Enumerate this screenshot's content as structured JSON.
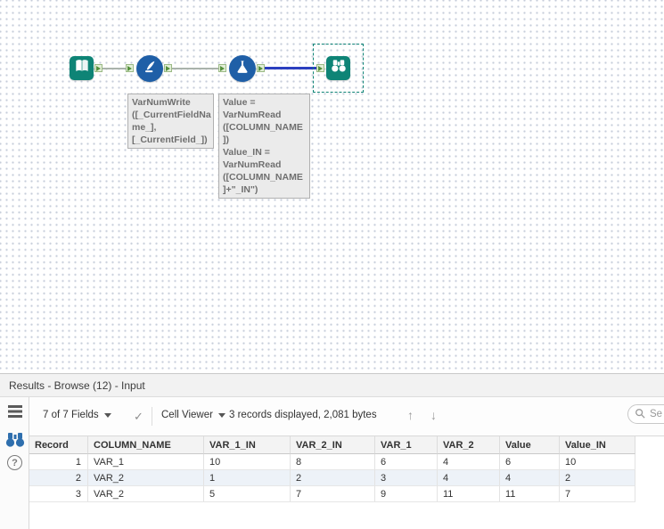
{
  "colors": {
    "tool_teal": "#0E8476",
    "tool_blue": "#1F5FA7",
    "selected_connection": "#2B3FBF",
    "selection_outline": "#0E8476"
  },
  "canvas": {
    "annotations": {
      "write_formula": "VarNumWrite\n([_CurrentFieldNa\nme_],\n[_CurrentField_])",
      "read_formula": "Value =\nVarNumRead\n([COLUMN_NAME\n])\nValue_IN =\nVarNumRead\n([COLUMN_NAME\n]+\"_IN\")"
    }
  },
  "results": {
    "title": "Results - Browse (12) - Input",
    "toolbar": {
      "fields": "7 of 7 Fields",
      "cell_viewer": "Cell Viewer",
      "records": "3 records displayed, 2,081 bytes",
      "search_placeholder": "Se"
    },
    "table": {
      "columns": [
        "Record",
        "COLUMN_NAME",
        "VAR_1_IN",
        "VAR_2_IN",
        "VAR_1",
        "VAR_2",
        "Value",
        "Value_IN"
      ],
      "rows": [
        [
          "1",
          "VAR_1",
          "10",
          "8",
          "6",
          "4",
          "6",
          "10"
        ],
        [
          "2",
          "VAR_2",
          "1",
          "2",
          "3",
          "4",
          "4",
          "2"
        ],
        [
          "3",
          "VAR_2",
          "5",
          "7",
          "9",
          "11",
          "11",
          "7"
        ]
      ]
    }
  },
  "icons": {
    "check": "✓",
    "up": "↑",
    "down": "↓",
    "help": "?"
  }
}
